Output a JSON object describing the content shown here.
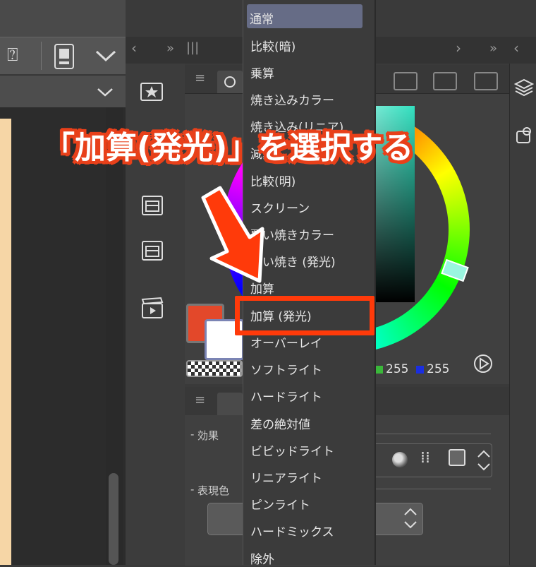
{
  "menu": {
    "items": [
      "通常",
      "比較(暗)",
      "乗算",
      "焼き込みカラー",
      "焼き込み(リニア)",
      "減算",
      "比較(明)",
      "スクリーン",
      "覆い焼きカラー",
      "覆い焼き (発光)",
      "加算",
      "加算 (発光)",
      "オーバーレイ",
      "ソフトライト",
      "ハードライト",
      "差の絶対値",
      "ビビッドライト",
      "リニアライト",
      "ピンライト",
      "ハードミックス",
      "除外"
    ],
    "selected_index": 0,
    "highlighted_index": 11
  },
  "annotation": {
    "headline": "「加算(発光)」を選択する"
  },
  "color_values": {
    "g": "255",
    "b": "255"
  },
  "layer_panel": {
    "effect_label": "効果",
    "expression_color_label": "表現色"
  },
  "colors": {
    "main_color": "#e3482a",
    "sub_color": "#ffffff",
    "highlight": "#ff3a0a",
    "menu_selected": "#666c86"
  }
}
